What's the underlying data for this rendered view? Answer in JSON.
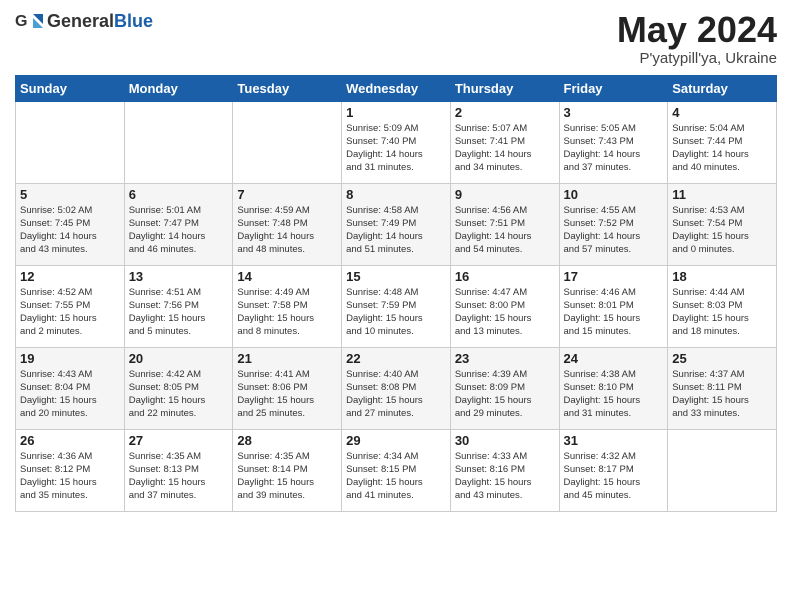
{
  "header": {
    "logo_general": "General",
    "logo_blue": "Blue",
    "month_title": "May 2024",
    "location": "P'yatypill'ya, Ukraine"
  },
  "weekdays": [
    "Sunday",
    "Monday",
    "Tuesday",
    "Wednesday",
    "Thursday",
    "Friday",
    "Saturday"
  ],
  "weeks": [
    [
      {
        "day": "",
        "info": ""
      },
      {
        "day": "",
        "info": ""
      },
      {
        "day": "",
        "info": ""
      },
      {
        "day": "1",
        "info": "Sunrise: 5:09 AM\nSunset: 7:40 PM\nDaylight: 14 hours\nand 31 minutes."
      },
      {
        "day": "2",
        "info": "Sunrise: 5:07 AM\nSunset: 7:41 PM\nDaylight: 14 hours\nand 34 minutes."
      },
      {
        "day": "3",
        "info": "Sunrise: 5:05 AM\nSunset: 7:43 PM\nDaylight: 14 hours\nand 37 minutes."
      },
      {
        "day": "4",
        "info": "Sunrise: 5:04 AM\nSunset: 7:44 PM\nDaylight: 14 hours\nand 40 minutes."
      }
    ],
    [
      {
        "day": "5",
        "info": "Sunrise: 5:02 AM\nSunset: 7:45 PM\nDaylight: 14 hours\nand 43 minutes."
      },
      {
        "day": "6",
        "info": "Sunrise: 5:01 AM\nSunset: 7:47 PM\nDaylight: 14 hours\nand 46 minutes."
      },
      {
        "day": "7",
        "info": "Sunrise: 4:59 AM\nSunset: 7:48 PM\nDaylight: 14 hours\nand 48 minutes."
      },
      {
        "day": "8",
        "info": "Sunrise: 4:58 AM\nSunset: 7:49 PM\nDaylight: 14 hours\nand 51 minutes."
      },
      {
        "day": "9",
        "info": "Sunrise: 4:56 AM\nSunset: 7:51 PM\nDaylight: 14 hours\nand 54 minutes."
      },
      {
        "day": "10",
        "info": "Sunrise: 4:55 AM\nSunset: 7:52 PM\nDaylight: 14 hours\nand 57 minutes."
      },
      {
        "day": "11",
        "info": "Sunrise: 4:53 AM\nSunset: 7:54 PM\nDaylight: 15 hours\nand 0 minutes."
      }
    ],
    [
      {
        "day": "12",
        "info": "Sunrise: 4:52 AM\nSunset: 7:55 PM\nDaylight: 15 hours\nand 2 minutes."
      },
      {
        "day": "13",
        "info": "Sunrise: 4:51 AM\nSunset: 7:56 PM\nDaylight: 15 hours\nand 5 minutes."
      },
      {
        "day": "14",
        "info": "Sunrise: 4:49 AM\nSunset: 7:58 PM\nDaylight: 15 hours\nand 8 minutes."
      },
      {
        "day": "15",
        "info": "Sunrise: 4:48 AM\nSunset: 7:59 PM\nDaylight: 15 hours\nand 10 minutes."
      },
      {
        "day": "16",
        "info": "Sunrise: 4:47 AM\nSunset: 8:00 PM\nDaylight: 15 hours\nand 13 minutes."
      },
      {
        "day": "17",
        "info": "Sunrise: 4:46 AM\nSunset: 8:01 PM\nDaylight: 15 hours\nand 15 minutes."
      },
      {
        "day": "18",
        "info": "Sunrise: 4:44 AM\nSunset: 8:03 PM\nDaylight: 15 hours\nand 18 minutes."
      }
    ],
    [
      {
        "day": "19",
        "info": "Sunrise: 4:43 AM\nSunset: 8:04 PM\nDaylight: 15 hours\nand 20 minutes."
      },
      {
        "day": "20",
        "info": "Sunrise: 4:42 AM\nSunset: 8:05 PM\nDaylight: 15 hours\nand 22 minutes."
      },
      {
        "day": "21",
        "info": "Sunrise: 4:41 AM\nSunset: 8:06 PM\nDaylight: 15 hours\nand 25 minutes."
      },
      {
        "day": "22",
        "info": "Sunrise: 4:40 AM\nSunset: 8:08 PM\nDaylight: 15 hours\nand 27 minutes."
      },
      {
        "day": "23",
        "info": "Sunrise: 4:39 AM\nSunset: 8:09 PM\nDaylight: 15 hours\nand 29 minutes."
      },
      {
        "day": "24",
        "info": "Sunrise: 4:38 AM\nSunset: 8:10 PM\nDaylight: 15 hours\nand 31 minutes."
      },
      {
        "day": "25",
        "info": "Sunrise: 4:37 AM\nSunset: 8:11 PM\nDaylight: 15 hours\nand 33 minutes."
      }
    ],
    [
      {
        "day": "26",
        "info": "Sunrise: 4:36 AM\nSunset: 8:12 PM\nDaylight: 15 hours\nand 35 minutes."
      },
      {
        "day": "27",
        "info": "Sunrise: 4:35 AM\nSunset: 8:13 PM\nDaylight: 15 hours\nand 37 minutes."
      },
      {
        "day": "28",
        "info": "Sunrise: 4:35 AM\nSunset: 8:14 PM\nDaylight: 15 hours\nand 39 minutes."
      },
      {
        "day": "29",
        "info": "Sunrise: 4:34 AM\nSunset: 8:15 PM\nDaylight: 15 hours\nand 41 minutes."
      },
      {
        "day": "30",
        "info": "Sunrise: 4:33 AM\nSunset: 8:16 PM\nDaylight: 15 hours\nand 43 minutes."
      },
      {
        "day": "31",
        "info": "Sunrise: 4:32 AM\nSunset: 8:17 PM\nDaylight: 15 hours\nand 45 minutes."
      },
      {
        "day": "",
        "info": ""
      }
    ]
  ]
}
